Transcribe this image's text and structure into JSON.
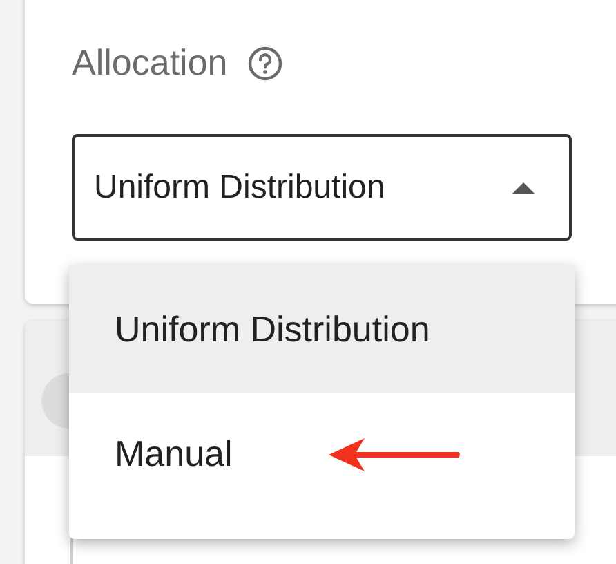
{
  "field": {
    "label": "Allocation",
    "value": "Uniform Distribution",
    "expanded": true
  },
  "menu": {
    "items": [
      {
        "label": "Uniform Distribution",
        "selected": true
      },
      {
        "label": "Manual",
        "selected": false
      }
    ]
  }
}
